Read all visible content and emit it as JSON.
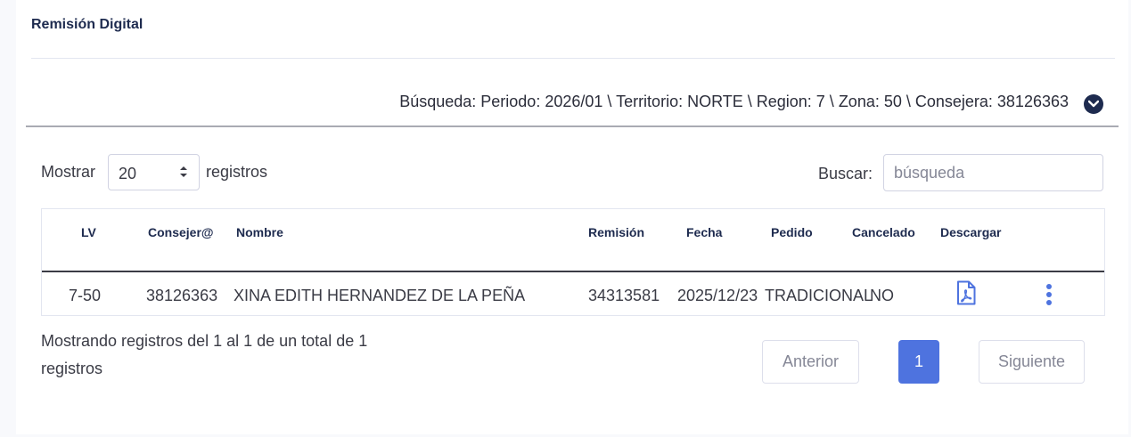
{
  "card": {
    "title": "Remisión Digital"
  },
  "filters": {
    "summary": "Búsqueda: Periodo: 2026/01 \\ Territorio: NORTE \\ Region: 7 \\ Zona: 50 \\ Consejera: 38126363",
    "toggle_icon": "chevron-down-circle-icon"
  },
  "length_control": {
    "prefix": "Mostrar",
    "value": "20",
    "suffix": "registros"
  },
  "search": {
    "label": "Buscar:",
    "placeholder": "búsqueda"
  },
  "table": {
    "columns": [
      "LV",
      "Consejer@",
      "Nombre",
      "Remisión",
      "Fecha",
      "Pedido",
      "Cancelado",
      "Descargar"
    ],
    "rows": [
      {
        "lv": "7-50",
        "consejera": "38126363",
        "nombre": "XINA EDITH HERNANDEZ DE LA PEÑA",
        "remision": "34313581",
        "fecha": "2025/12/23",
        "pedido": "TRADICIONAL",
        "cancelado": "NO",
        "descargar_icon": "file-pdf-icon",
        "actions_icon": "more-vertical-icon"
      }
    ]
  },
  "footer": {
    "info": "Mostrando registros del 1 al 1 de un total de 1 registros",
    "pagination": {
      "previous": "Anterior",
      "current": "1",
      "next": "Siguiente"
    }
  },
  "colors": {
    "accent": "#4e73df",
    "heading": "#1e2b4f"
  }
}
